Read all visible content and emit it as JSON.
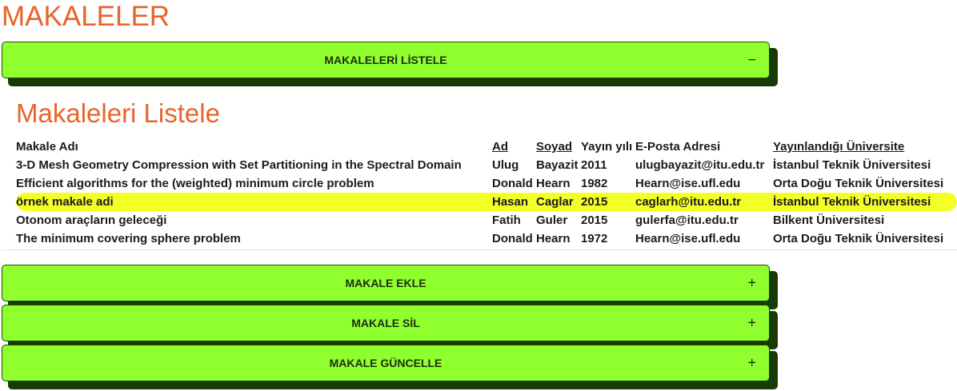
{
  "page": {
    "title": "MAKALELER"
  },
  "accordions": [
    {
      "label": "MAKALELERİ LİSTELE",
      "sign": "−"
    },
    {
      "label": "MAKALE EKLE",
      "sign": "+"
    },
    {
      "label": "MAKALE SİL",
      "sign": "+"
    },
    {
      "label": "MAKALE GÜNCELLE",
      "sign": "+"
    }
  ],
  "list": {
    "title": "Makaleleri Listele",
    "columns": [
      "Makale Adı",
      "Ad",
      "Soyad",
      "Yayın yılı",
      "E-Posta Adresi",
      "Yayınlandığı Üniversite"
    ],
    "rows": [
      [
        "3-D Mesh Geometry Compression with Set Partitioning in the Spectral Domain",
        "Ulug",
        "Bayazit",
        "2011",
        "ulugbayazit@itu.edu.tr",
        "İstanbul Teknik Üniversitesi"
      ],
      [
        "Efficient algorithms for the (weighted) minimum circle problem",
        "Donald",
        "Hearn",
        "1982",
        "Hearn@ise.ufl.edu",
        "Orta Doğu Teknik Üniversitesi"
      ],
      [
        "örnek makale adi",
        "Hasan",
        "Caglar",
        "2015",
        "caglarh@itu.edu.tr",
        "İstanbul Teknik Üniversitesi"
      ],
      [
        "Otonom araçların geleceği",
        "Fatih",
        "Guler",
        "2015",
        "gulerfa@itu.edu.tr",
        "Bilkent Üniversitesi"
      ],
      [
        "The minimum covering sphere problem",
        "Donald",
        "Hearn",
        "1972",
        "Hearn@ise.ufl.edu",
        "Orta Doğu Teknik Üniversitesi"
      ]
    ]
  },
  "colors": {
    "accent": "#e8632a",
    "button": "#90ff2e",
    "highlight": "#f3ff27"
  }
}
